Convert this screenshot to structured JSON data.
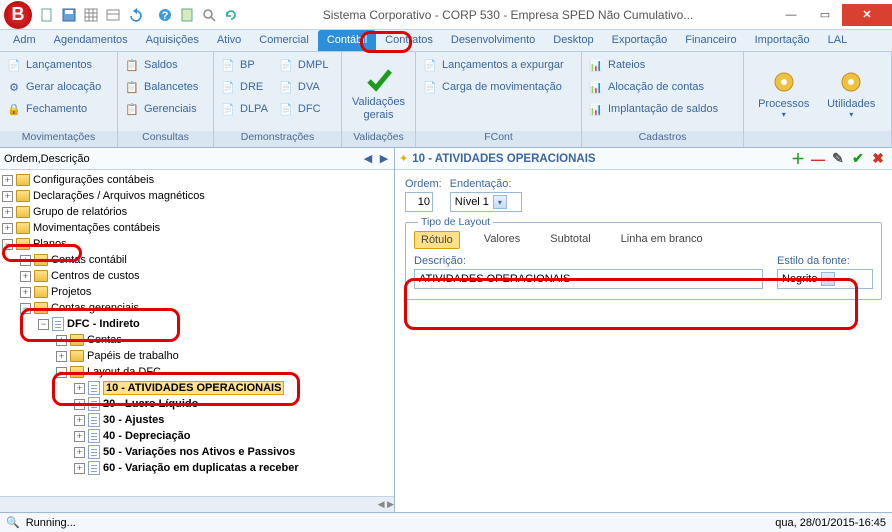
{
  "title": "Sistema Corporativo - CORP 530 - Empresa SPED Não Cumulativo...",
  "menutabs": [
    "Adm",
    "Agendamentos",
    "Aquisições",
    "Ativo",
    "Comercial",
    "Contábil",
    "Contratos",
    "Desenvolvimento",
    "Desktop",
    "Exportação",
    "Financeiro",
    "Importação",
    "LAL"
  ],
  "active_tab": "Contábil",
  "ribbon": {
    "mov": {
      "label": "Movimentações",
      "items": [
        "Lançamentos",
        "Gerar alocação",
        "Fechamento"
      ]
    },
    "con": {
      "label": "Consultas",
      "items": [
        "Saldos",
        "Balancetes",
        "Gerenciais"
      ]
    },
    "dem": {
      "label": "Demonstrações",
      "colA": [
        "BP",
        "DRE",
        "DLPA"
      ],
      "colB": [
        "DMPL",
        "DVA",
        "DFC"
      ]
    },
    "val": {
      "label": "Validações",
      "big": "Validações gerais"
    },
    "fcont": {
      "label": "FCont",
      "items": [
        "Lançamentos a expurgar",
        "Carga de movimentação"
      ]
    },
    "cad": {
      "label": "Cadastros",
      "items": [
        "Rateios",
        "Alocação de contas",
        "Implantação de saldos"
      ]
    },
    "proc": {
      "label": "",
      "bigA": "Processos",
      "bigB": "Utilidades"
    }
  },
  "tree_header": "Ordem,Descrição",
  "tree": {
    "t0": "Configurações contábeis",
    "t1": "Declarações / Arquivos magnéticos",
    "t2": "Grupo de relatórios",
    "t3": "Movimentações contábeis",
    "t4": "Planos",
    "t4c": {
      "a": "Contas contábil",
      "b": "Centros de custos",
      "c": "Projetos",
      "d": "Contas gerenciais",
      "dc": {
        "a": "DFC - Indireto",
        "ac": {
          "a": "Contas",
          "b": "Papéis de trabalho",
          "c": "Layout da DFC",
          "cc": {
            "l10": "10 - ATIVIDADES OPERACIONAIS",
            "l20": "20 - Lucro Líquido",
            "l30": "30 - Ajustes",
            "l40": "40 - Depreciação",
            "l50": "50 - Variações nos Ativos e Passivos",
            "l60": "60 - Variação em duplicatas a receber"
          }
        }
      }
    }
  },
  "detail": {
    "title": "10 - ATIVIDADES OPERACIONAIS",
    "ordem_label": "Ordem:",
    "ordem_value": "10",
    "endent_label": "Endentação:",
    "endent_value": "Nível 1",
    "fieldset_label": "Tipo de Layout",
    "tabs": [
      "Rótulo",
      "Valores",
      "Subtotal",
      "Linha em branco"
    ],
    "tabs_active": "Rótulo",
    "desc_label": "Descrição:",
    "desc_value": "ATIVIDADES OPERACIONAIS",
    "estilo_label": "Estilo da fonte:",
    "estilo_value": "Negrito"
  },
  "status": {
    "run": "Running...",
    "datetime": "qua, 28/01/2015-16:45"
  }
}
